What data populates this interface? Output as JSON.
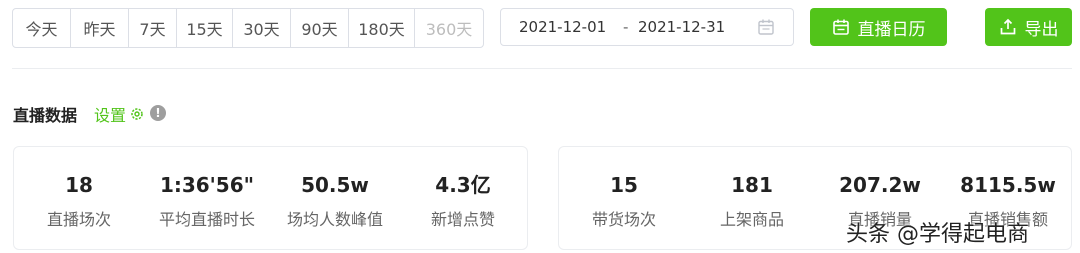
{
  "range_buttons": [
    {
      "label": "今天",
      "disabled": false
    },
    {
      "label": "昨天",
      "disabled": false
    },
    {
      "label": "7天",
      "disabled": false
    },
    {
      "label": "15天",
      "disabled": false
    },
    {
      "label": "30天",
      "disabled": false
    },
    {
      "label": "90天",
      "disabled": false
    },
    {
      "label": "180天",
      "disabled": false
    },
    {
      "label": "360天",
      "disabled": true
    }
  ],
  "date_range": {
    "start": "2021-12-01",
    "separator": "-",
    "end": "2021-12-31",
    "icon": "calendar-icon"
  },
  "toolbar": {
    "calendar_button": "直播日历",
    "export_button": "导出"
  },
  "section": {
    "title": "直播数据",
    "settings": "设置",
    "info_icon": "!"
  },
  "live_stats": [
    {
      "value": "18",
      "label": "直播场次"
    },
    {
      "value": "1:36'56\"",
      "label": "平均直播时长"
    },
    {
      "value": "50.5w",
      "label": "场均人数峰值"
    },
    {
      "value": "4.3亿",
      "label": "新增点赞"
    }
  ],
  "sales_stats": [
    {
      "value": "15",
      "label": "带货场次"
    },
    {
      "value": "181",
      "label": "上架商品"
    },
    {
      "value": "207.2w",
      "label": "直播销量"
    },
    {
      "value": "8115.5w",
      "label": "直播销售额"
    }
  ],
  "watermark": "头条 @学得起电商",
  "colors": {
    "accent": "#52c41a",
    "border": "#dcdfe6",
    "disabled_text": "#bdbdbd"
  }
}
